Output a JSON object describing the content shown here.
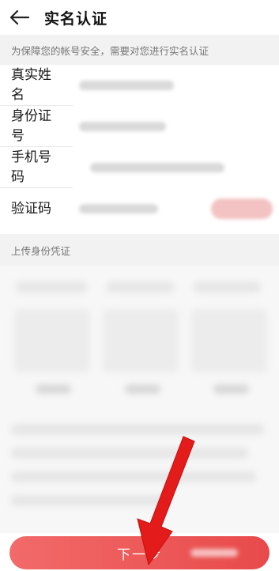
{
  "header": {
    "title": "实名认证"
  },
  "notice": "为保障您的帐号安全，需要对您进行实名认证",
  "form": {
    "name_label": [
      "真实姓",
      "名"
    ],
    "id_label": [
      "身份证",
      "号"
    ],
    "phone_label": [
      "手机号",
      "码"
    ],
    "code_label": "验证码"
  },
  "upload_section": {
    "title": "上传身份凭证"
  },
  "next_button": {
    "label": "下一步"
  },
  "colors": {
    "accent": "#e84a4a",
    "arrow": "#e31b1b"
  }
}
